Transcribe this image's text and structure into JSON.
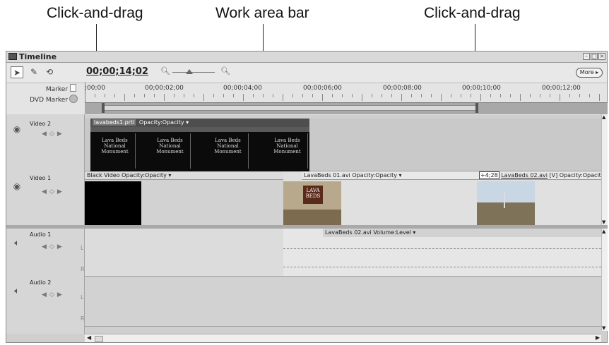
{
  "callouts": {
    "left": "Click-and-drag",
    "center": "Work area bar",
    "right": "Click-and-drag"
  },
  "window": {
    "title": "Timeline",
    "timecode": "00;00;14;02",
    "more_button": "More",
    "zoom_level": 0.4
  },
  "markers": {
    "marker_label": "Marker",
    "dvd_marker_label": "DVD Marker"
  },
  "ruler": {
    "ticks": [
      ":00;00",
      "00;00;02;00",
      "00;00;04;00",
      "00;00;06;00",
      "00;00;08;00",
      "00;00;10;00",
      "00;00;12;00"
    ]
  },
  "tracks": {
    "video2": {
      "name": "Video 2",
      "clip_name": "lavabeds1.prtl",
      "clip_effect": "Opacity:Opacity",
      "title_lines": [
        "Lava Beds",
        "National",
        "Monument"
      ]
    },
    "video1": {
      "name": "Video 1",
      "clip1_label": "Black Video Opacity:Opacity",
      "clip2_label": "LavaBeds 01.avi Opacity:Opacity",
      "clip3_offset": "+4;28",
      "clip3_name": "LavaBeds 02.avi",
      "clip3_rest": "[V] Opacity:Opacity",
      "sign_text": [
        "LAVA",
        "BEDS"
      ]
    },
    "audio1": {
      "name": "Audio 1",
      "clip_label": "LavaBeds 02.avi Volume:Level",
      "channel_left": "L",
      "channel_right": "R"
    },
    "audio2": {
      "name": "Audio 2",
      "channel_left": "L",
      "channel_right": "R"
    }
  }
}
